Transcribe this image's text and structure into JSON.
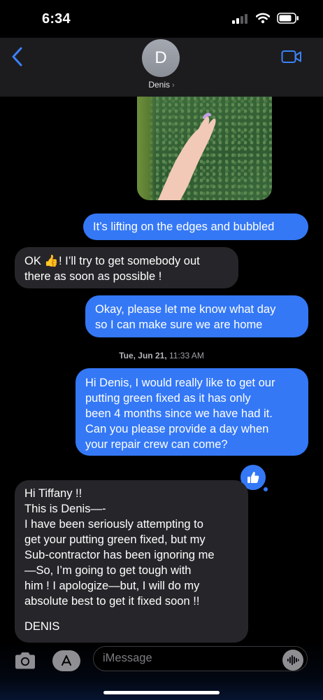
{
  "status_bar": {
    "time": "6:34"
  },
  "header": {
    "avatar_initial": "D",
    "contact_name": "Denis",
    "name_chevron": "›"
  },
  "messages": [
    {
      "direction": "outgoing",
      "lines": [
        "It’s lifting on the edges and bubbled"
      ]
    },
    {
      "direction": "incoming",
      "lines": [
        "OK 👍!  I’ll try to get somebody out",
        "there as soon as possible !"
      ]
    },
    {
      "direction": "outgoing",
      "lines": [
        "Okay, please let me know what day",
        "so I can make sure we are home"
      ]
    },
    {
      "direction": "outgoing",
      "lines": [
        "Hi Denis, I would really like to get our",
        "putting green fixed as it has only",
        "been 4 months since we have had it.",
        "Can you please provide a day when",
        "your repair crew can come?"
      ],
      "tapback": "thumbs-up"
    },
    {
      "direction": "incoming",
      "lines": [
        "Hi Tiffany !!",
        "This is Denis—-",
        "I have been seriously attempting to",
        "get your putting green fixed, but my",
        "Sub-contractor has been ignoring me",
        "—So, I’m going to get tough with",
        "him !  I apologize—but, I will do my",
        "absolute best to get it fixed soon !!",
        "",
        "DENIS"
      ]
    }
  ],
  "timestamp": {
    "day": "Tue, Jun 21,",
    "time": "11:33 AM"
  },
  "composer": {
    "placeholder": "iMessage"
  },
  "colors": {
    "outgoing_bubble": "#3478f6",
    "incoming_bubble": "#26262a",
    "background": "#000000"
  },
  "icons": [
    "back-chevron-icon",
    "video-call-icon",
    "camera-icon",
    "app-store-icon",
    "audio-waveform-icon",
    "thumbs-up-icon",
    "signal-icon",
    "wifi-icon",
    "battery-icon"
  ]
}
